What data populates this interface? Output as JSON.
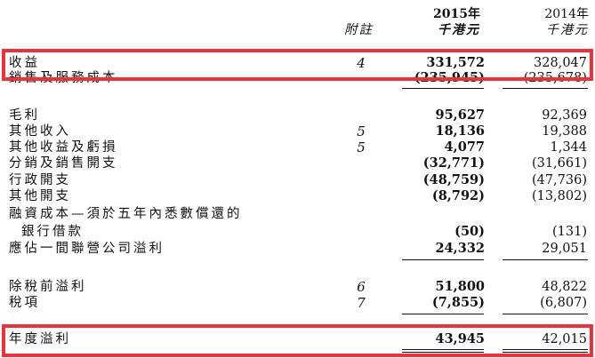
{
  "header": {
    "note_label": "附註",
    "col2015_year": "2015年",
    "col2015_unit": "千港元",
    "col2014_year": "2014年",
    "col2014_unit": "千港元"
  },
  "rows": [
    {
      "label": "收益",
      "note": "4",
      "v2015": "331,572",
      "v2014": "328,047"
    },
    {
      "label": "銷售及服務成本",
      "note": "",
      "v2015": "(235,945)",
      "v2014": "(235,678)"
    },
    {
      "label": "毛利",
      "note": "",
      "v2015": "95,627",
      "v2014": "92,369"
    },
    {
      "label": "其他收入",
      "note": "5",
      "v2015": "18,136",
      "v2014": "19,388"
    },
    {
      "label": "其他收益及虧損",
      "note": "5",
      "v2015": "4,077",
      "v2014": "1,344"
    },
    {
      "label": "分銷及銷售開支",
      "note": "",
      "v2015": "(32,771)",
      "v2014": "(31,661)"
    },
    {
      "label": "行政開支",
      "note": "",
      "v2015": "(48,759)",
      "v2014": "(47,736)"
    },
    {
      "label": "其他開支",
      "note": "",
      "v2015": "(8,792)",
      "v2014": "(13,802)"
    },
    {
      "label": "融資成本—須於五年內悉數償還的",
      "note": "",
      "v2015": "",
      "v2014": ""
    },
    {
      "label": "銀行借款",
      "note": "",
      "v2015": "(50)",
      "v2014": "(131)"
    },
    {
      "label": "應佔一間聯營公司溢利",
      "note": "",
      "v2015": "24,332",
      "v2014": "29,051"
    },
    {
      "label": "除稅前溢利",
      "note": "6",
      "v2015": "51,800",
      "v2014": "48,822"
    },
    {
      "label": "稅項",
      "note": "7",
      "v2015": "(7,855)",
      "v2014": "(6,807)"
    },
    {
      "label": "年度溢利",
      "note": "",
      "v2015": "43,945",
      "v2014": "42,015"
    }
  ],
  "highlight_color": "#e8333a"
}
